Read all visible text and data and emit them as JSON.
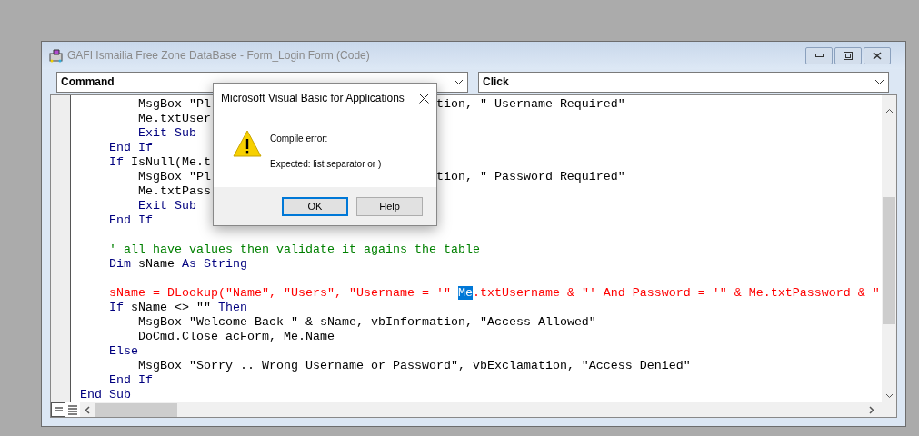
{
  "window": {
    "title": "GAFI Ismailia Free Zone DataBase - Form_Login Form (Code)"
  },
  "object_combo": {
    "value": "Command"
  },
  "procedure_combo": {
    "value": "Click"
  },
  "code": {
    "lines": [
      {
        "kind": "code",
        "tokens": [
          {
            "text": "        MsgBox \"Pl",
            "kind": "plain"
          }
        ],
        "right": [
          {
            "text": "tion, \" Username Required\"",
            "kind": "plain"
          }
        ]
      },
      {
        "kind": "code",
        "tokens": [
          {
            "text": "        Me.txtUser",
            "kind": "plain"
          }
        ]
      },
      {
        "kind": "code",
        "tokens": [
          {
            "text": "        Exit Sub",
            "kind": "kw"
          }
        ]
      },
      {
        "kind": "code",
        "tokens": [
          {
            "text": "    End If",
            "kind": "kw"
          }
        ]
      },
      {
        "kind": "code",
        "tokens": [
          {
            "text": "    If",
            "kind": "kw"
          },
          {
            "text": " IsNull(Me.t",
            "kind": "plain"
          }
        ]
      },
      {
        "kind": "code",
        "tokens": [
          {
            "text": "        MsgBox \"Pl",
            "kind": "plain"
          }
        ],
        "right": [
          {
            "text": "tion, \" Password Required\"",
            "kind": "plain"
          }
        ]
      },
      {
        "kind": "code",
        "tokens": [
          {
            "text": "        Me.txtPass",
            "kind": "plain"
          }
        ]
      },
      {
        "kind": "code",
        "tokens": [
          {
            "text": "        Exit Sub",
            "kind": "kw"
          }
        ]
      },
      {
        "kind": "code",
        "tokens": [
          {
            "text": "    End If",
            "kind": "kw"
          }
        ]
      },
      {
        "kind": "blank"
      },
      {
        "kind": "code",
        "tokens": [
          {
            "text": "    ' all have values then validate it agains the table",
            "kind": "comment"
          }
        ]
      },
      {
        "kind": "code",
        "tokens": [
          {
            "text": "    Dim",
            "kind": "kw"
          },
          {
            "text": " sName ",
            "kind": "plain"
          },
          {
            "text": "As String",
            "kind": "kw"
          }
        ]
      },
      {
        "kind": "blank"
      },
      {
        "kind": "code",
        "tokens": [
          {
            "text": "    sName = DLookup(\"Name\", \"Users\", \"Username = '\" ",
            "kind": "error"
          },
          {
            "text": "Me",
            "kind": "selection"
          },
          {
            "text": ".txtUsername & \"' And Password = '\" & Me.txtPassword & \"",
            "kind": "error"
          }
        ]
      },
      {
        "kind": "code",
        "tokens": [
          {
            "text": "    If",
            "kind": "kw"
          },
          {
            "text": " sName <> \"\" ",
            "kind": "plain"
          },
          {
            "text": "Then",
            "kind": "kw"
          }
        ]
      },
      {
        "kind": "code",
        "tokens": [
          {
            "text": "        MsgBox \"Welcome Back \" & sName, vbInformation, \"Access Allowed\"",
            "kind": "plain"
          }
        ]
      },
      {
        "kind": "code",
        "tokens": [
          {
            "text": "        DoCmd.Close acForm, Me.Name",
            "kind": "plain"
          }
        ]
      },
      {
        "kind": "code",
        "tokens": [
          {
            "text": "    Else",
            "kind": "kw"
          }
        ]
      },
      {
        "kind": "code",
        "tokens": [
          {
            "text": "        MsgBox \"Sorry .. Wrong Username or Password\", vbExclamation, \"Access Denied\"",
            "kind": "plain"
          }
        ]
      },
      {
        "kind": "code",
        "tokens": [
          {
            "text": "    End If",
            "kind": "kw"
          }
        ]
      },
      {
        "kind": "code",
        "tokens": [
          {
            "text": "End Sub",
            "kind": "kw"
          }
        ]
      }
    ]
  },
  "dialog": {
    "title": "Microsoft Visual Basic for Applications",
    "heading": "Compile error:",
    "message": "Expected: list separator or )",
    "buttons": [
      {
        "label": "OK",
        "selected": true
      },
      {
        "label": "Help",
        "selected": false
      }
    ]
  }
}
